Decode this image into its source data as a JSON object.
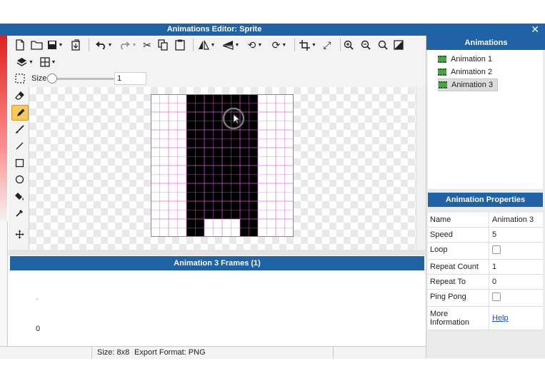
{
  "window": {
    "title": "Animations Editor: Sprite",
    "close_glyph": "✕"
  },
  "toolbar": {
    "icons": [
      "new-file-icon",
      "open-folder-icon",
      "save-icon",
      "export-icon",
      "undo-icon",
      "redo-icon",
      "cut-icon",
      "copy-icon",
      "paste-icon",
      "flip-horizontal-icon",
      "flip-vertical-icon",
      "rotate-left-icon",
      "rotate-right-icon",
      "crop-icon",
      "resize-icon",
      "zoom-in-icon",
      "zoom-out-icon",
      "zoom-fit-icon",
      "fill-background-icon",
      "layers-icon",
      "grid-icon",
      "select-icon"
    ],
    "size_label": "Size",
    "size_value": "1",
    "size_slider_value": 0
  },
  "tools": [
    "eraser-icon",
    "pencil-icon",
    "brush-icon",
    "line-icon",
    "rectangle-icon",
    "ellipse-icon",
    "paint-bucket-icon",
    "eyedropper-icon",
    "pan-icon"
  ],
  "frames_panel": {
    "title": "Animation 3 Frames (1)",
    "dash": "-",
    "frame_index": "0"
  },
  "status": {
    "size": "Size: 8x8",
    "format": "Export Format: PNG"
  },
  "animations_panel": {
    "title": "Animations",
    "items": [
      {
        "label": "Animation 1",
        "selected": false
      },
      {
        "label": "Animation 2",
        "selected": false
      },
      {
        "label": "Animation 3",
        "selected": true
      }
    ]
  },
  "properties_panel": {
    "title": "Animation Properties",
    "rows": [
      {
        "key": "Name",
        "value": "Animation 3"
      },
      {
        "key": "Speed",
        "value": "5"
      },
      {
        "key": "Loop",
        "checked": false
      },
      {
        "key": "Repeat Count",
        "value": "1"
      },
      {
        "key": "Repeat To",
        "value": "0"
      },
      {
        "key": "Ping Pong",
        "checked": false
      },
      {
        "key": "More Information",
        "link": "Help"
      }
    ]
  },
  "sprite": {
    "width": 8,
    "height": 8,
    "pixels": [
      "00111100",
      "00111100",
      "00111100",
      "00111100",
      "00111100",
      "00111100",
      "00111100",
      "00100100"
    ],
    "fill_color": "#000000",
    "grid_color": "#e060e0"
  },
  "colors": {
    "accent": "#1f62a6",
    "selected_tool": "#f6c95c"
  }
}
